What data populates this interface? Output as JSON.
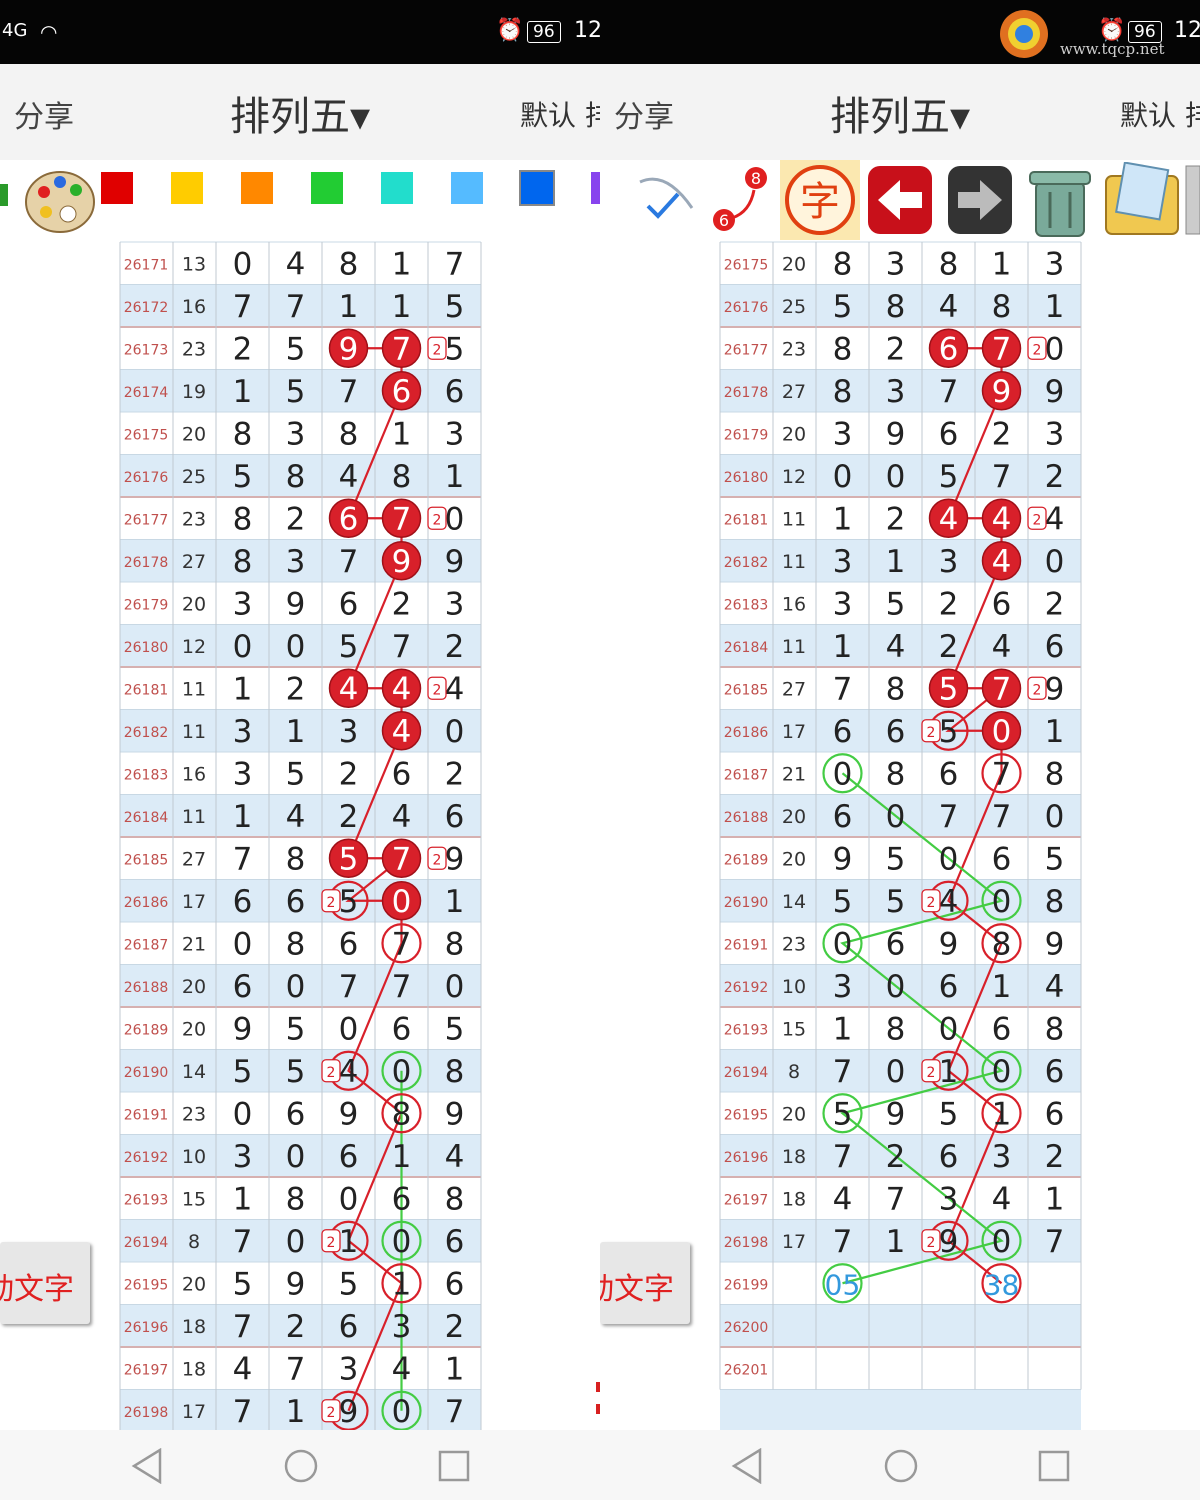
{
  "watermark": "www.tqcp.net",
  "status": {
    "signal": "4G",
    "battery": "96",
    "time": "12"
  },
  "appbar": {
    "share": "分享",
    "title": "排列五▾",
    "default": "默认 排"
  },
  "side_button": {
    "label": "动文字"
  },
  "colors": {
    "red": "#e00000",
    "yellow": "#ffcc00",
    "orange": "#ff8800",
    "green": "#22cc33",
    "teal": "#22ddcc",
    "sky": "#55bbff",
    "blue": "#0066ee",
    "purple": "#8844ee",
    "circle": "#d8202a",
    "green_line": "#44cc44",
    "blank_blue": "#3399dd"
  },
  "toolbar_icons": [
    "palette-icon",
    "pen-icon",
    "character-icon",
    "back-arrow-icon",
    "forward-arrow-icon",
    "trash-icon",
    "images-icon"
  ],
  "left": {
    "rows": [
      {
        "period": "26171",
        "sum": "13",
        "digits": [
          "0",
          "4",
          "8",
          "1",
          "7"
        ]
      },
      {
        "period": "26172",
        "sum": "16",
        "digits": [
          "7",
          "7",
          "1",
          "1",
          "5"
        ]
      },
      {
        "period": "26173",
        "sum": "23",
        "digits": [
          "2",
          "5",
          "9",
          "7",
          "5"
        ]
      },
      {
        "period": "26174",
        "sum": "19",
        "digits": [
          "1",
          "5",
          "7",
          "6",
          "6"
        ]
      },
      {
        "period": "26175",
        "sum": "20",
        "digits": [
          "8",
          "3",
          "8",
          "1",
          "3"
        ]
      },
      {
        "period": "26176",
        "sum": "25",
        "digits": [
          "5",
          "8",
          "4",
          "8",
          "1"
        ]
      },
      {
        "period": "26177",
        "sum": "23",
        "digits": [
          "8",
          "2",
          "6",
          "7",
          "0"
        ]
      },
      {
        "period": "26178",
        "sum": "27",
        "digits": [
          "8",
          "3",
          "7",
          "9",
          "9"
        ]
      },
      {
        "period": "26179",
        "sum": "20",
        "digits": [
          "3",
          "9",
          "6",
          "2",
          "3"
        ]
      },
      {
        "period": "26180",
        "sum": "12",
        "digits": [
          "0",
          "0",
          "5",
          "7",
          "2"
        ]
      },
      {
        "period": "26181",
        "sum": "11",
        "digits": [
          "1",
          "2",
          "4",
          "4",
          "4"
        ]
      },
      {
        "period": "26182",
        "sum": "11",
        "digits": [
          "3",
          "1",
          "3",
          "4",
          "0"
        ]
      },
      {
        "period": "26183",
        "sum": "16",
        "digits": [
          "3",
          "5",
          "2",
          "6",
          "2"
        ]
      },
      {
        "period": "26184",
        "sum": "11",
        "digits": [
          "1",
          "4",
          "2",
          "4",
          "6"
        ]
      },
      {
        "period": "26185",
        "sum": "27",
        "digits": [
          "7",
          "8",
          "5",
          "7",
          "9"
        ]
      },
      {
        "period": "26186",
        "sum": "17",
        "digits": [
          "6",
          "6",
          "5",
          "0",
          "1"
        ]
      },
      {
        "period": "26187",
        "sum": "21",
        "digits": [
          "0",
          "8",
          "6",
          "7",
          "8"
        ]
      },
      {
        "period": "26188",
        "sum": "20",
        "digits": [
          "6",
          "0",
          "7",
          "7",
          "0"
        ]
      },
      {
        "period": "26189",
        "sum": "20",
        "digits": [
          "9",
          "5",
          "0",
          "6",
          "5"
        ]
      },
      {
        "period": "26190",
        "sum": "14",
        "digits": [
          "5",
          "5",
          "4",
          "0",
          "8"
        ]
      },
      {
        "period": "26191",
        "sum": "23",
        "digits": [
          "0",
          "6",
          "9",
          "8",
          "9"
        ]
      },
      {
        "period": "26192",
        "sum": "10",
        "digits": [
          "3",
          "0",
          "6",
          "1",
          "4"
        ]
      },
      {
        "period": "26193",
        "sum": "15",
        "digits": [
          "1",
          "8",
          "0",
          "6",
          "8"
        ]
      },
      {
        "period": "26194",
        "sum": "8",
        "digits": [
          "7",
          "0",
          "1",
          "0",
          "6"
        ]
      },
      {
        "period": "26195",
        "sum": "20",
        "digits": [
          "5",
          "9",
          "5",
          "1",
          "6"
        ]
      },
      {
        "period": "26196",
        "sum": "18",
        "digits": [
          "7",
          "2",
          "6",
          "3",
          "2"
        ]
      },
      {
        "period": "26197",
        "sum": "18",
        "digits": [
          "4",
          "7",
          "3",
          "4",
          "1"
        ]
      },
      {
        "period": "26198",
        "sum": "17",
        "digits": [
          "7",
          "1",
          "9",
          "0",
          "7"
        ]
      }
    ]
  },
  "right": {
    "rows": [
      {
        "period": "26175",
        "sum": "20",
        "digits": [
          "8",
          "3",
          "8",
          "1",
          "3"
        ]
      },
      {
        "period": "26176",
        "sum": "25",
        "digits": [
          "5",
          "8",
          "4",
          "8",
          "1"
        ]
      },
      {
        "period": "26177",
        "sum": "23",
        "digits": [
          "8",
          "2",
          "6",
          "7",
          "0"
        ]
      },
      {
        "period": "26178",
        "sum": "27",
        "digits": [
          "8",
          "3",
          "7",
          "9",
          "9"
        ]
      },
      {
        "period": "26179",
        "sum": "20",
        "digits": [
          "3",
          "9",
          "6",
          "2",
          "3"
        ]
      },
      {
        "period": "26180",
        "sum": "12",
        "digits": [
          "0",
          "0",
          "5",
          "7",
          "2"
        ]
      },
      {
        "period": "26181",
        "sum": "11",
        "digits": [
          "1",
          "2",
          "4",
          "4",
          "4"
        ]
      },
      {
        "period": "26182",
        "sum": "11",
        "digits": [
          "3",
          "1",
          "3",
          "4",
          "0"
        ]
      },
      {
        "period": "26183",
        "sum": "16",
        "digits": [
          "3",
          "5",
          "2",
          "6",
          "2"
        ]
      },
      {
        "period": "26184",
        "sum": "11",
        "digits": [
          "1",
          "4",
          "2",
          "4",
          "6"
        ]
      },
      {
        "period": "26185",
        "sum": "27",
        "digits": [
          "7",
          "8",
          "5",
          "7",
          "9"
        ]
      },
      {
        "period": "26186",
        "sum": "17",
        "digits": [
          "6",
          "6",
          "5",
          "0",
          "1"
        ]
      },
      {
        "period": "26187",
        "sum": "21",
        "digits": [
          "0",
          "8",
          "6",
          "7",
          "8"
        ]
      },
      {
        "period": "26188",
        "sum": "20",
        "digits": [
          "6",
          "0",
          "7",
          "7",
          "0"
        ]
      },
      {
        "period": "26189",
        "sum": "20",
        "digits": [
          "9",
          "5",
          "0",
          "6",
          "5"
        ]
      },
      {
        "period": "26190",
        "sum": "14",
        "digits": [
          "5",
          "5",
          "4",
          "0",
          "8"
        ]
      },
      {
        "period": "26191",
        "sum": "23",
        "digits": [
          "0",
          "6",
          "9",
          "8",
          "9"
        ]
      },
      {
        "period": "26192",
        "sum": "10",
        "digits": [
          "3",
          "0",
          "6",
          "1",
          "4"
        ]
      },
      {
        "period": "26193",
        "sum": "15",
        "digits": [
          "1",
          "8",
          "0",
          "6",
          "8"
        ]
      },
      {
        "period": "26194",
        "sum": "8",
        "digits": [
          "7",
          "0",
          "1",
          "0",
          "6"
        ]
      },
      {
        "period": "26195",
        "sum": "20",
        "digits": [
          "5",
          "9",
          "5",
          "1",
          "6"
        ]
      },
      {
        "period": "26196",
        "sum": "18",
        "digits": [
          "7",
          "2",
          "6",
          "3",
          "2"
        ]
      },
      {
        "period": "26197",
        "sum": "18",
        "digits": [
          "4",
          "7",
          "3",
          "4",
          "1"
        ]
      },
      {
        "period": "26198",
        "sum": "17",
        "digits": [
          "7",
          "1",
          "9",
          "0",
          "7"
        ]
      },
      {
        "period": "26199",
        "sum": "",
        "digits": [
          "05",
          "",
          "",
          "38",
          ""
        ]
      },
      {
        "period": "26200",
        "sum": "",
        "digits": [
          "",
          "",
          "",
          "",
          ""
        ]
      },
      {
        "period": "26201",
        "sum": "",
        "digits": [
          "",
          "",
          "",
          "",
          ""
        ]
      }
    ]
  },
  "badge": "2",
  "marks": {
    "left": {
      "filled": [
        [
          2,
          2
        ],
        [
          2,
          3
        ],
        [
          3,
          3
        ],
        [
          6,
          2
        ],
        [
          6,
          3
        ],
        [
          7,
          3
        ],
        [
          10,
          2
        ],
        [
          10,
          3
        ],
        [
          11,
          3
        ],
        [
          14,
          2
        ],
        [
          14,
          3
        ],
        [
          15,
          3
        ]
      ],
      "red_ring": [
        [
          15,
          2
        ],
        [
          16,
          3
        ],
        [
          19,
          2
        ],
        [
          20,
          3
        ],
        [
          23,
          2
        ],
        [
          24,
          3
        ],
        [
          27,
          2
        ]
      ],
      "green_ring": [
        [
          19,
          3
        ],
        [
          23,
          3
        ],
        [
          27,
          3
        ]
      ],
      "badges": [
        [
          2,
          3
        ],
        [
          6,
          3
        ],
        [
          10,
          3
        ],
        [
          14,
          3
        ],
        [
          15,
          1
        ],
        [
          19,
          1
        ],
        [
          23,
          1
        ],
        [
          27,
          1
        ]
      ]
    },
    "right": {
      "filled": [
        [
          2,
          2
        ],
        [
          2,
          3
        ],
        [
          3,
          3
        ],
        [
          6,
          2
        ],
        [
          6,
          3
        ],
        [
          7,
          3
        ],
        [
          10,
          2
        ],
        [
          10,
          3
        ],
        [
          11,
          3
        ]
      ],
      "red_ring": [
        [
          11,
          2
        ],
        [
          12,
          3
        ],
        [
          15,
          2
        ],
        [
          16,
          3
        ],
        [
          19,
          2
        ],
        [
          20,
          3
        ],
        [
          23,
          2
        ],
        [
          24,
          3
        ]
      ],
      "green_ring": [
        [
          12,
          0
        ],
        [
          15,
          3
        ],
        [
          16,
          0
        ],
        [
          19,
          3
        ],
        [
          20,
          0
        ],
        [
          23,
          3
        ],
        [
          24,
          0
        ]
      ],
      "badges": [
        [
          2,
          3
        ],
        [
          6,
          3
        ],
        [
          10,
          3
        ],
        [
          11,
          1
        ],
        [
          15,
          1
        ],
        [
          19,
          1
        ],
        [
          23,
          1
        ]
      ]
    }
  }
}
